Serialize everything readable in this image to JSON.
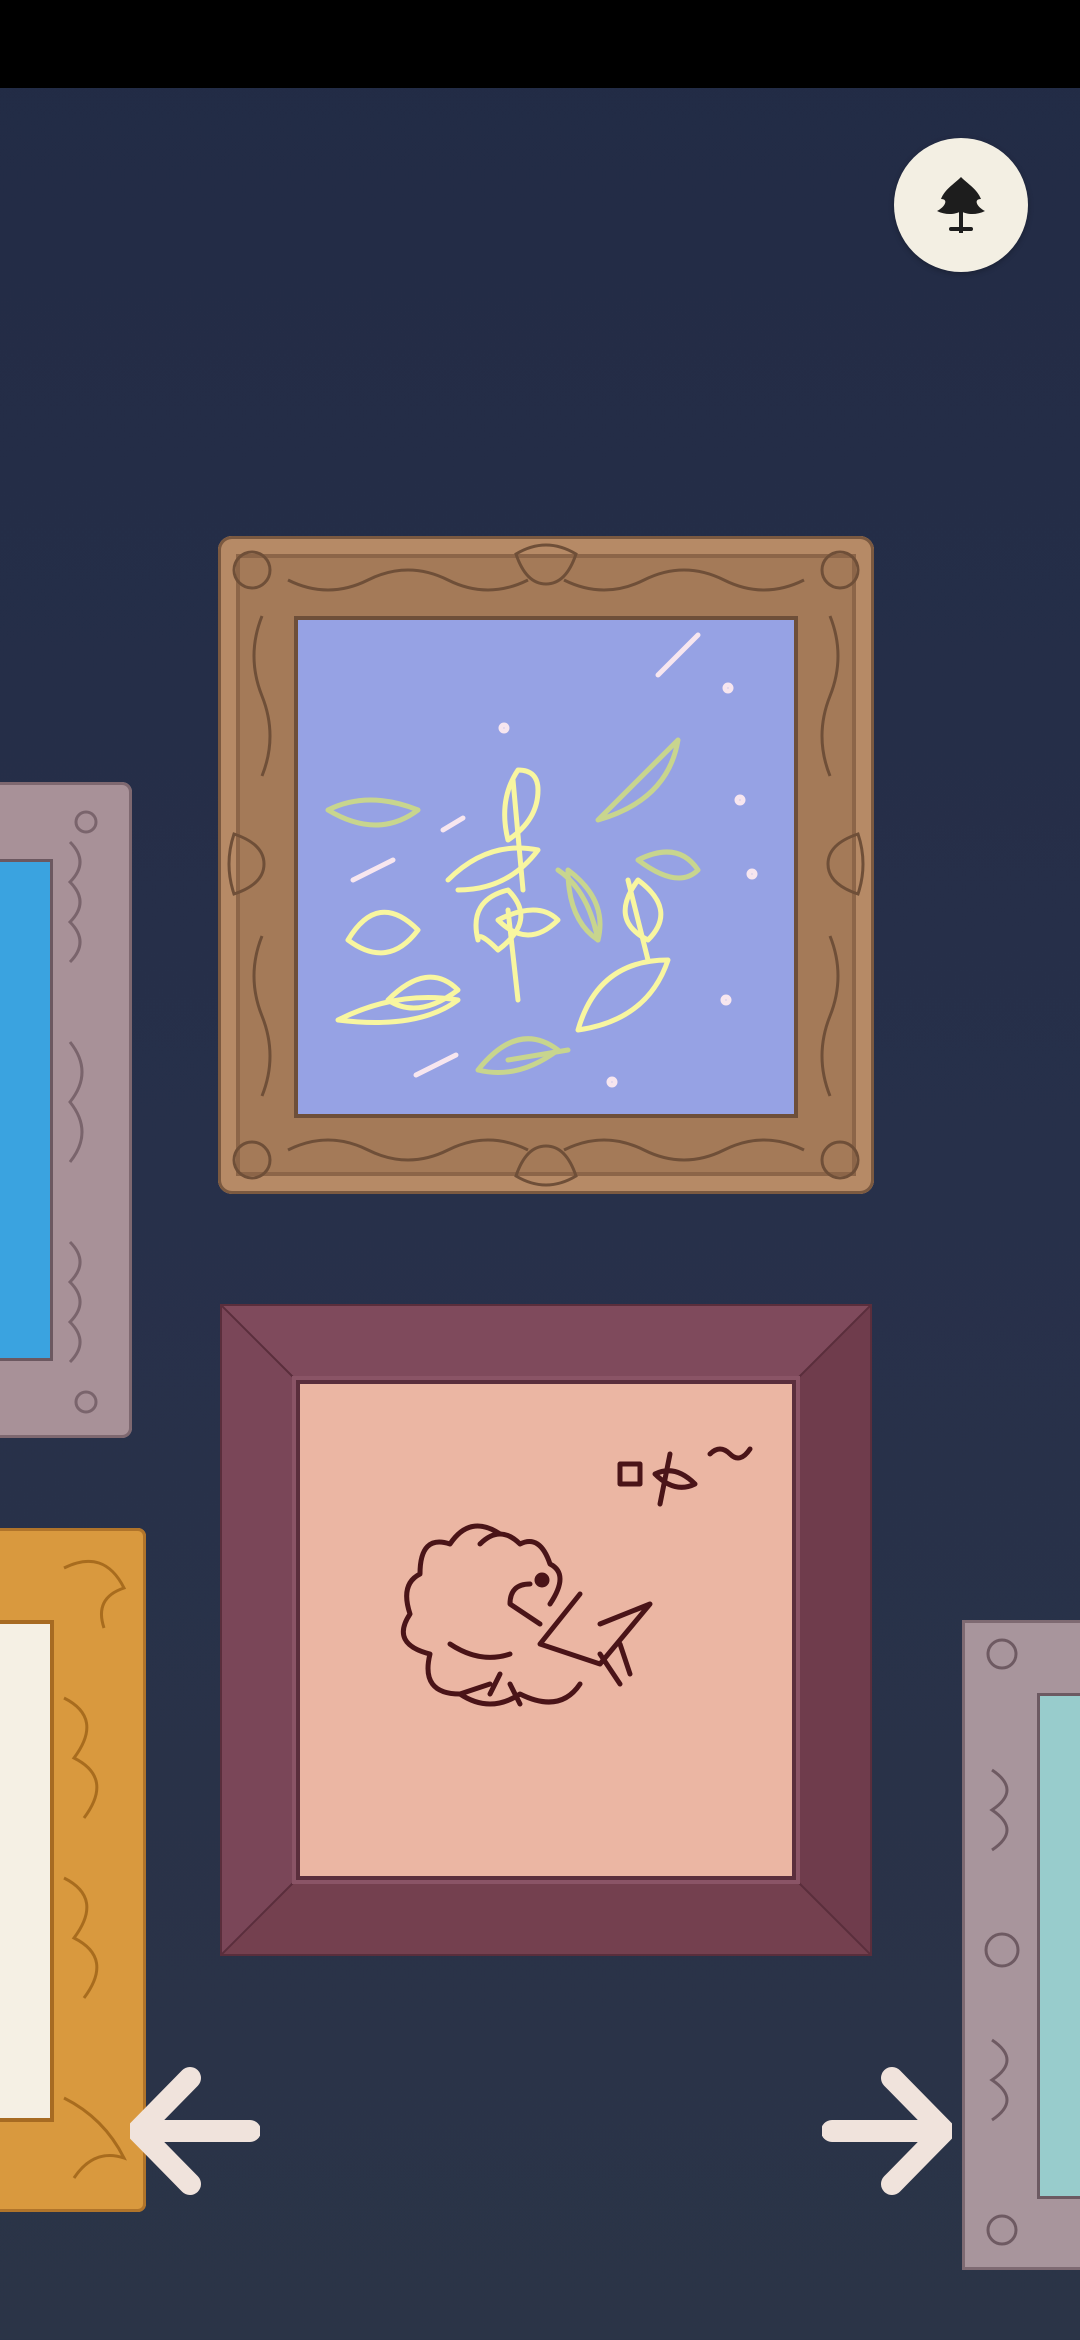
{
  "screen": {
    "background": "#252e48"
  },
  "icons": {
    "theme_button": "leaf-icon",
    "prev": "arrow-left-icon",
    "next": "arrow-right-icon"
  },
  "gallery": {
    "paintings": [
      {
        "name": "falling-leaves",
        "frame": "ornate-brown",
        "canvas_color": "#96a2e4"
      },
      {
        "name": "curly-bird",
        "frame": "plum-bevel",
        "canvas_color": "#ebb6a3"
      },
      {
        "name": "partial-left-blue",
        "frame": "grey-ornate",
        "canvas_color": "#3aa3e0"
      },
      {
        "name": "partial-left-cream",
        "frame": "gold-ornate",
        "canvas_color": "#f5f0e4"
      },
      {
        "name": "partial-right-teal",
        "frame": "grey-ornate",
        "canvas_color": "#98cccc"
      }
    ]
  },
  "colors": {
    "accent_light": "#f3efe3",
    "icon_dark": "#1d1d1d"
  }
}
